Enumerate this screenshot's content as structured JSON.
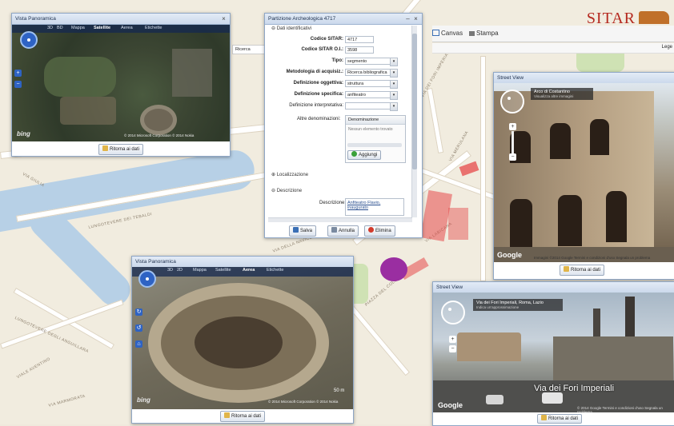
{
  "app": {
    "logo_text": "SITAR",
    "toolbar": {
      "canvas_label": "Canvas",
      "print_label": "Stampa",
      "legend_label": "Lege",
      "search_label": "Ricerca"
    },
    "accent_color": "#b5291f"
  },
  "map": {
    "street_labels": [
      "VIA GIULIA",
      "LUNGOTEVERE DEI TEBALDI",
      "LUNGOTEVERE DEGLI ANGUILLARA",
      "VIA DEI FORI IMPERIALI",
      "PIAZZA DEL COLOSSEO",
      "VIA LABICANA",
      "VIA MERULANA",
      "VIA DELLA NAVICELLA",
      "VIALE AVENTINO",
      "VIA MARMORATA"
    ]
  },
  "panorama_top": {
    "title": "Vista Panoramica",
    "tabs": [
      "3D",
      "BD",
      "Mappa",
      "Satellite",
      "Aerea",
      "Etichette"
    ],
    "active_tab": "Satellite",
    "bing": "bing",
    "attribution": "© 2014 Microsoft Corporation  © 2014 Nokia",
    "back_button": "Ritorna ai dati"
  },
  "form": {
    "title": "Partizione Archeologica 4717",
    "section_data": "Dati identificativi",
    "rows": [
      {
        "label": "Codice SITAR:",
        "value": "4717",
        "type": "text"
      },
      {
        "label": "Codice SITAR O.I.:",
        "value": "3598",
        "type": "text"
      },
      {
        "label": "Tipo:",
        "value": "segmento",
        "type": "select"
      },
      {
        "label": "Metodologia di acquisiz.:",
        "value": "Ricerca bibliografica",
        "type": "select"
      },
      {
        "label": "Definizione oggettiva:",
        "value": "struttura",
        "type": "select"
      },
      {
        "label": "Definizione specifica:",
        "value": "anfiteatro",
        "type": "select"
      },
      {
        "label": "Definizione interpretativa:",
        "value": "",
        "type": "select"
      }
    ],
    "other_names_label": "Altre denominazioni:",
    "other_names_header": "Denominazione",
    "other_names_empty": "Nessun elemento trovato",
    "add_label": "Aggiungi",
    "section_location": "Localizzazione",
    "section_description": "Descrizione",
    "description_label": "Descrizione:",
    "description_value": "Anfiteatro Flavio, inaugurato",
    "save_label": "Salva",
    "cancel_label": "Annulla",
    "delete_label": "Elimina"
  },
  "streetview_top": {
    "title": "Street View",
    "info_line1": "Arco di Costantino",
    "info_line2": "Visualizza altre immagini",
    "google": "Google",
    "attribution": "Immagini ©2014 Google  Termini e condizioni d'uso  Segnala un problema",
    "back_button": "Ritorna ai dati"
  },
  "panorama_bottom": {
    "title": "Vista Panoramica",
    "tabs": [
      "3D",
      "2D",
      "Mappa",
      "Satellite",
      "Aerea",
      "Etichette"
    ],
    "active_tab": "Aerea",
    "bing": "bing",
    "scale": "50 m",
    "attribution": "© 2014 Microsoft Corporation  © 2014 Nokia",
    "back_button": "Ritorna ai dati"
  },
  "streetview_bottom": {
    "title": "Street View",
    "info_line1": "Via dei Fori Imperiali, Roma, Lazio",
    "info_line2": "Indica un'approssimazione",
    "caption": "Via dei Fori Imperiali",
    "google": "Google",
    "attribution": "© 2014 Google  Termini e condizioni d'uso  Segnala un problema",
    "back_button": "Ritorna ai dati"
  }
}
